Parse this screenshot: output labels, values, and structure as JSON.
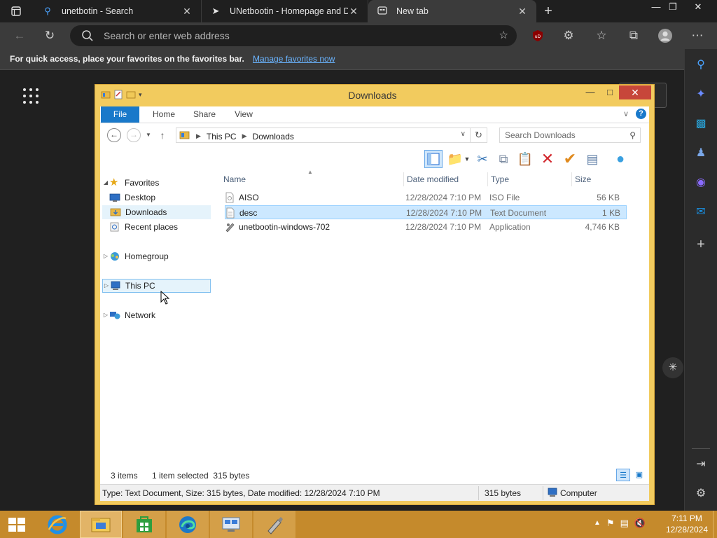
{
  "browser": {
    "tabs": [
      {
        "title": "unetbotin - Search",
        "icon": "search-icon"
      },
      {
        "title": "UNetbootin - Homepage and Do",
        "icon": "rocket-icon"
      },
      {
        "title": "New tab",
        "icon": "newtab-icon"
      }
    ],
    "address_placeholder": "Search or enter web address",
    "favorites_bar": {
      "message": "For quick access, place your favorites on the favorites bar.",
      "link": "Manage favorites now"
    }
  },
  "explorer": {
    "title": "Downloads",
    "ribbon_tabs": [
      "File",
      "Home",
      "Share",
      "View"
    ],
    "address": {
      "crumbs": [
        "This PC",
        "Downloads"
      ]
    },
    "search_placeholder": "Search Downloads",
    "nav": {
      "favorites": "Favorites",
      "desktop": "Desktop",
      "downloads": "Downloads",
      "recent": "Recent places",
      "homegroup": "Homegroup",
      "thispc": "This PC",
      "network": "Network"
    },
    "columns": [
      "Name",
      "Date modified",
      "Type",
      "Size"
    ],
    "files": [
      {
        "name": "AISO",
        "date": "12/28/2024 7:10 PM",
        "type": "ISO File",
        "size": "56 KB",
        "icon": "iso-file-icon"
      },
      {
        "name": "desc",
        "date": "12/28/2024 7:10 PM",
        "type": "Text Document",
        "size": "1 KB",
        "icon": "text-file-icon",
        "selected": true
      },
      {
        "name": "unetbootin-windows-702",
        "date": "12/28/2024 7:10 PM",
        "type": "Application",
        "size": "4,746 KB",
        "icon": "app-icon"
      }
    ],
    "status": {
      "items": "3 items",
      "selected": "1 item selected  315 bytes"
    },
    "details": {
      "info": "Type: Text Document, Size: 315 bytes, Date modified: 12/28/2024 7:10 PM",
      "size": "315 bytes",
      "location": "Computer"
    }
  },
  "taskbar": {
    "time": "7:11 PM",
    "date": "12/28/2024"
  },
  "colors": {
    "explorer_frame": "#f2cb5e",
    "taskbar": "#c58a2c",
    "selection": "#cce8ff",
    "file_tab": "#1979ca",
    "close_button": "#c7463a"
  }
}
